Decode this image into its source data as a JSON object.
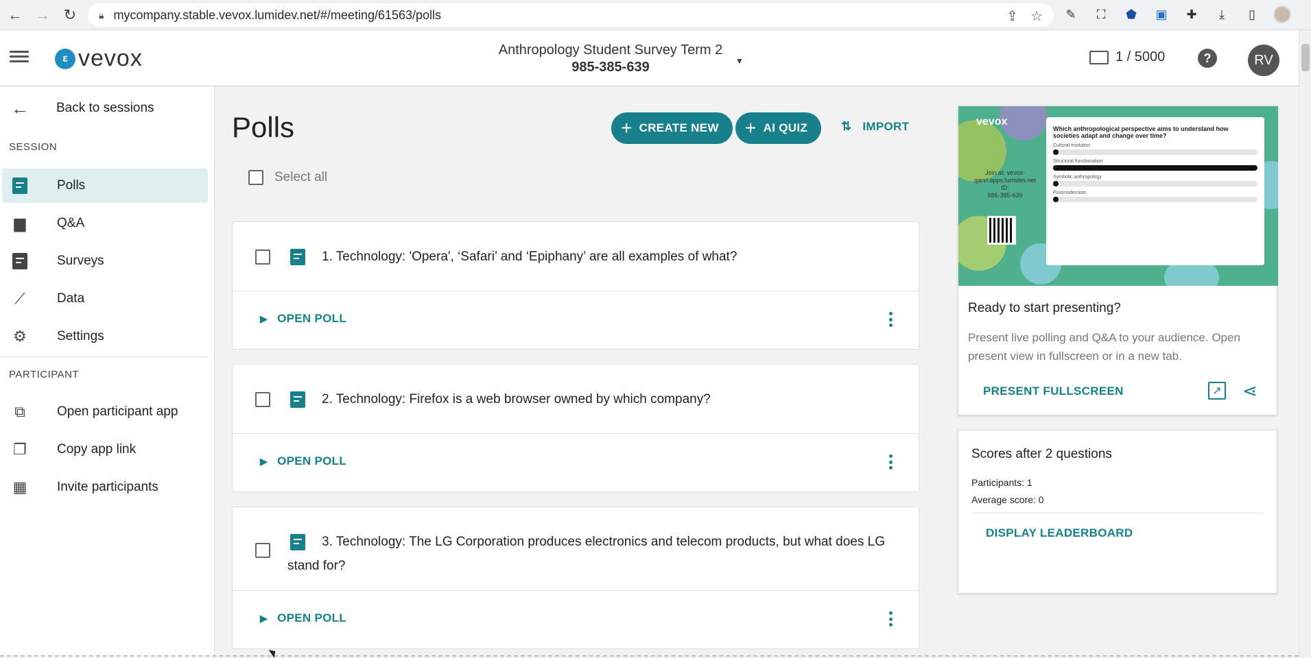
{
  "browser": {
    "url": "mycompany.stable.vevox.lumidev.net/#/meeting/61563/polls"
  },
  "header": {
    "logo_text": "vevox",
    "session_name": "Anthropology Student Survey Term 2",
    "session_code": "985-385-639",
    "participant_count": "1 / 5000",
    "user_initials": "RV"
  },
  "sidebar": {
    "back_label": "Back to sessions",
    "session_section": "SESSION",
    "session_items": [
      {
        "label": "Polls",
        "icon": "poll-icon",
        "active": true
      },
      {
        "label": "Q&A",
        "icon": "chat-icon"
      },
      {
        "label": "Surveys",
        "icon": "clipboard-icon"
      },
      {
        "label": "Data",
        "icon": "chart-line-icon"
      },
      {
        "label": "Settings",
        "icon": "gear-icon"
      }
    ],
    "participant_section": "PARTICIPANT",
    "participant_items": [
      {
        "label": "Open participant app",
        "icon": "open-external-icon"
      },
      {
        "label": "Copy app link",
        "icon": "copy-icon"
      },
      {
        "label": "Invite participants",
        "icon": "calendar-icon"
      }
    ]
  },
  "main": {
    "title": "Polls",
    "create_new_label": "CREATE NEW",
    "ai_quiz_label": "AI QUIZ",
    "import_label": "IMPORT",
    "select_all_label": "Select all",
    "open_poll_label": "OPEN POLL",
    "polls": [
      {
        "question": "1. Technology: 'Opera', ‘Safari’ and ‘Epiphany’ are all examples of what?"
      },
      {
        "question": "2. Technology: Firefox is a web browser owned by which company?"
      },
      {
        "question": "3. Technology: The LG Corporation produces electronics and telecom products, but what does LG stand for?"
      }
    ]
  },
  "preview": {
    "logo": "vevox",
    "slide_question": "Which anthropological perspective aims to understand how societies adapt and change over time?",
    "slide_options": [
      "Cultural evolution",
      "Structural functionalism",
      "Symbolic anthropology",
      "Postmodernism"
    ],
    "join_text": "Join at: vevox-qarel.apps.lumidev.net",
    "id_label": "ID:",
    "id_value": "985-385-639",
    "ready_title": "Ready to start presenting?",
    "ready_desc": "Present live polling and Q&A to your audience. Open present view in fullscreen or in a new tab.",
    "present_fullscreen_label": "PRESENT FULLSCREEN"
  },
  "scores": {
    "title": "Scores after 2 questions",
    "participants": "Participants: 1",
    "average": "Average score: 0",
    "leaderboard_label": "DISPLAY LEADERBOARD"
  },
  "colors": {
    "accent": "#17808a",
    "active_bg": "#dfeff0"
  }
}
